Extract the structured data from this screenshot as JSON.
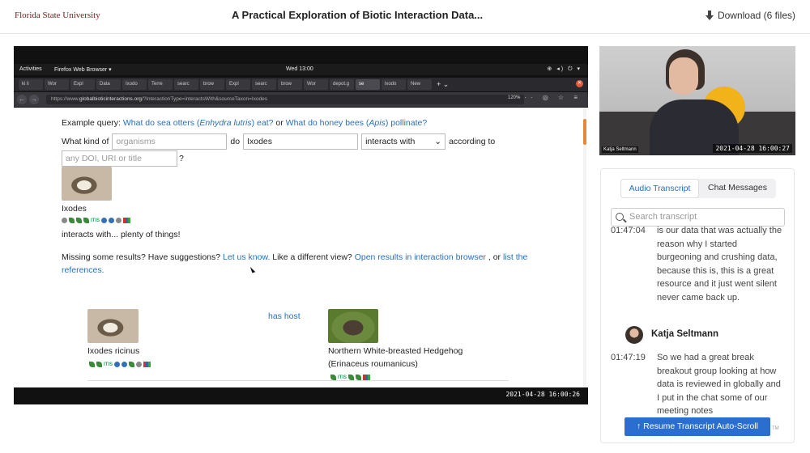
{
  "header": {
    "brand": "Florida State University",
    "title": "A Practical Exploration of Biotic Interaction Data...",
    "download_label": "Download (6 files)"
  },
  "video": {
    "os_bar": {
      "activities": "Activities",
      "app": "Firefox Web Browser ▾",
      "clock": "Wed 13:00",
      "system_icons": "⊕ ◂) ⏻ ▾"
    },
    "tabs": [
      "ki li",
      "Wor",
      "Expl",
      "Data",
      "Ixodo",
      "Terre",
      "searc",
      "brow",
      "Expl",
      "searc",
      "brow",
      "Wor",
      "depot.g",
      "se",
      "lxodo",
      "New"
    ],
    "active_tab_index": 13,
    "url_prefix": "https://www.",
    "url_domain": "globalbioticinteractions.org",
    "url_rest": "/?interactionType=interactsWith&sourceTaxon=Ixodes",
    "zoom": "120%",
    "page": {
      "q1_prefix": "Example query: ",
      "q1_link1_a": "What do sea otters (",
      "q1_link1_i": "Enhydra lutris",
      "q1_link1_b": ") eat?",
      "q1_or": " or ",
      "q1_link2_a": "What do honey bees (",
      "q1_link2_i": "Apis",
      "q1_link2_b": ") pollinate?",
      "q2_what_kind": "What kind of",
      "organisms_placeholder": "organisms",
      "do_word": "do",
      "taxon_value": "Ixodes",
      "interaction_value": "interacts with",
      "according_to": "according to",
      "doi_placeholder": "any DOI, URI or title",
      "question_mark": "?",
      "taxon_label": "Ixodes",
      "interacts_summary": "interacts with... plenty of things!",
      "missing_prefix": "Missing some results? Have suggestions? ",
      "let_us_know": "Let us know.",
      "different_view": " Like a different view? ",
      "open_results": "Open results in interaction browser",
      "or_word": " , or ",
      "list_refs": "list the references.",
      "row": {
        "source_name": "Ixodes ricinus",
        "interaction": "has host",
        "target_name": "Northern White-breasted Hedgehog",
        "target_sci": "(Erinaceus roumanicus)"
      }
    },
    "timestamp": "2021-04-28 16:00:26"
  },
  "speaker": {
    "name": "Katja Seltmann",
    "timestamp": "2021-04-28 16:00:27"
  },
  "transcript": {
    "tab_audio": "Audio Transcript",
    "tab_chat": "Chat Messages",
    "search_placeholder": "Search transcript",
    "entry1": {
      "time": "01:47:04",
      "text": "is our data that was actually the reason why I started burgeoning and crushing data, because this is, this is a great resource and it just went silent never came back up."
    },
    "speaker_name": "Katja Seltmann",
    "entry2": {
      "time": "01:47:19",
      "text": "So we had a great break breakout group looking at how data is reviewed in globally and I put in the chat some of our meeting notes"
    },
    "resume_button": "Resume Transcript Auto-Scroll",
    "tm": "TM"
  },
  "colors": {
    "brand": "#7a1b1b",
    "link": "#2a6fba",
    "button": "#2a6fd0",
    "accent_sun": "#f1b21a"
  }
}
